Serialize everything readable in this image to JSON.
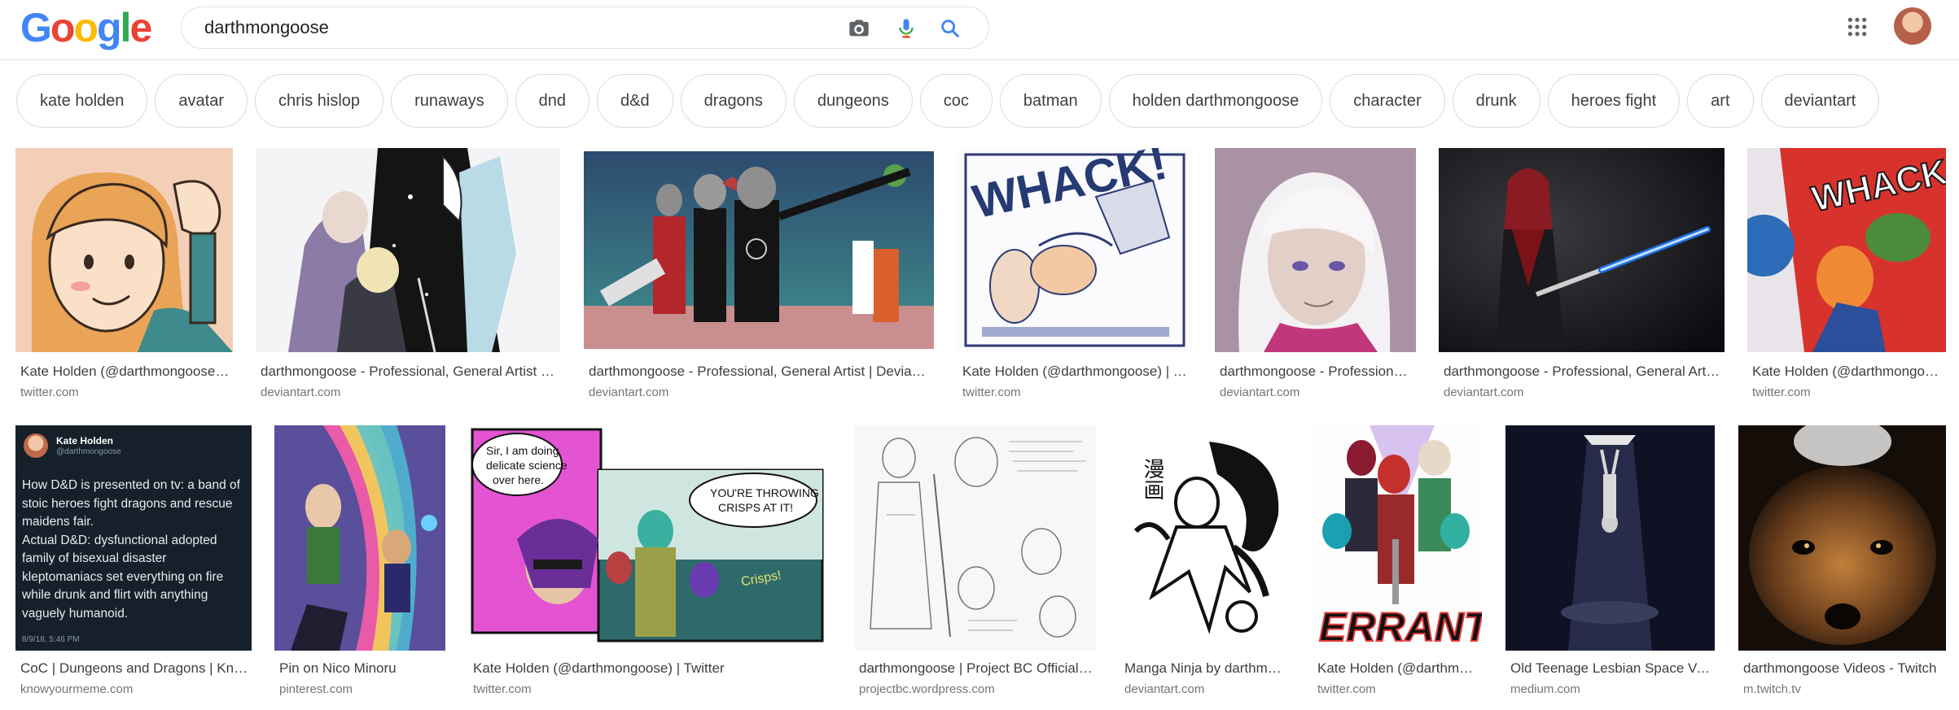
{
  "header": {
    "logo_letters": [
      "G",
      "o",
      "o",
      "g",
      "l",
      "e"
    ],
    "search": {
      "value": "darthmongoose"
    },
    "icons": {
      "camera": "camera-icon",
      "mic": "microphone-icon",
      "search": "search-icon",
      "apps": "apps-grid-icon",
      "avatar": "user-avatar"
    }
  },
  "chips": [
    "kate holden",
    "avatar",
    "chris hislop",
    "runaways",
    "dnd",
    "d&d",
    "dragons",
    "dungeons",
    "coc",
    "batman",
    "holden darthmongoose",
    "character",
    "drunk",
    "heroes fight",
    "art",
    "deviantart"
  ],
  "results": {
    "row1": [
      {
        "title": "Kate Holden (@darthmongoose) | Twitter",
        "source": "twitter.com"
      },
      {
        "title": "darthmongoose - Professional, General Artist | DeviantArt",
        "source": "deviantart.com"
      },
      {
        "title": "darthmongoose - Professional, General Artist | DeviantArt",
        "source": "deviantart.com"
      },
      {
        "title": "Kate Holden (@darthmongoose) | Twitter",
        "source": "twitter.com"
      },
      {
        "title": "darthmongoose - Professional, General Artist",
        "source": "deviantart.com"
      },
      {
        "title": "darthmongoose - Professional, General Artist | DeviantArt",
        "source": "deviantart.com"
      },
      {
        "title": "Kate Holden (@darthmongoose) | Twitter",
        "source": "twitter.com"
      }
    ],
    "row2": [
      {
        "title": "CoC | Dungeons and Dragons | Know Your Meme",
        "source": "knowyourmeme.com"
      },
      {
        "title": "Pin on Nico Minoru",
        "source": "pinterest.com"
      },
      {
        "title": "Kate Holden (@darthmongoose) | Twitter",
        "source": "twitter.com"
      },
      {
        "title": "darthmongoose | Project BC Official Site",
        "source": "projectbc.wordpress.com"
      },
      {
        "title": "Manga Ninja by darthmongoose on DeviantArt",
        "source": "deviantart.com"
      },
      {
        "title": "Kate Holden (@darthmongoose) | Twitter",
        "source": "twitter.com"
      },
      {
        "title": "Old Teenage Lesbian Space Vampires",
        "source": "medium.com"
      },
      {
        "title": "darthmongoose Videos - Twitch",
        "source": "m.twitch.tv"
      }
    ]
  },
  "image_text": {
    "tweet_name": "Kate Holden",
    "tweet_handle": "@darthmongoose",
    "tweet_lines": [
      "How D&D is presented on tv: a band of",
      "stoic heroes fight dragons and rescue",
      "maidens fair.",
      "Actual D&D: dysfunctional adopted",
      "family of bisexual disaster",
      "kleptomaniacs set everything on fire",
      "while drunk and flirt with anything",
      "vaguely humanoid."
    ],
    "tweet_date": "8/9/18, 5:46 PM",
    "whack": "WHACK!",
    "bubble1": [
      "Sir, I am doing",
      "delicate science",
      "over here."
    ],
    "bubble2": [
      "YOU'RE THROWING",
      "CRISPS AT IT!"
    ],
    "crisps": "Crisps!",
    "errant": "ERRANT",
    "manga": "漫画"
  },
  "colors": {
    "link_title": "#3c4043",
    "source": "#70757a",
    "chip_border": "#dadce0",
    "search_blue": "#4285F4"
  }
}
